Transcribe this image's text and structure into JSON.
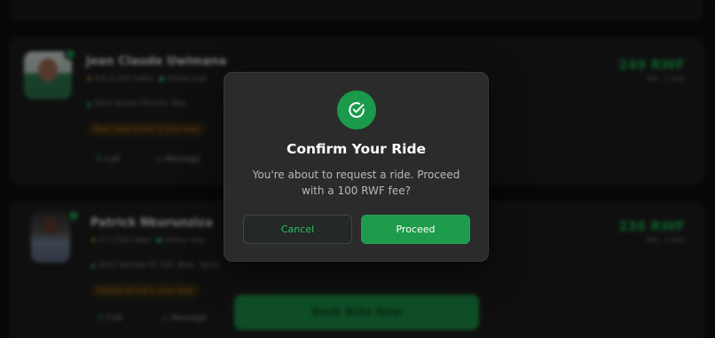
{
  "drivers": [
    {
      "name": "Jean Claude Uwimana",
      "rating": "4.9",
      "rides": "(1,247 rides)",
      "status": "Online now",
      "car": "2022 Honda CR-V-EX",
      "plate": "Red",
      "pill": "Best rated driver in your area",
      "price": "249 RWF",
      "eta": "5m · 1 min",
      "call_label": "Call",
      "message_label": "Message"
    },
    {
      "name": "Patrick Nkurunziza",
      "rating": "4.7",
      "rides": "(756 rides)",
      "status": "Online now",
      "car": "2021 Yamaha FZ 150",
      "plate": "Blue · Sport",
      "pill": "Fastest arrival in your area",
      "price": "236 RWF",
      "eta": "4m · 3 min",
      "call_label": "Call",
      "message_label": "Message"
    }
  ],
  "book_button_label": "Book Ride Now",
  "modal": {
    "title": "Confirm Your Ride",
    "body": "You're about to request a ride. Proceed with a 100 RWF fee?",
    "cancel_label": "Cancel",
    "proceed_label": "Proceed",
    "icon": "check-circle-icon"
  },
  "colors": {
    "accent": "#1e9c4b",
    "modal_bg": "#2b2b2b",
    "cancel_text": "#2fbf63"
  }
}
